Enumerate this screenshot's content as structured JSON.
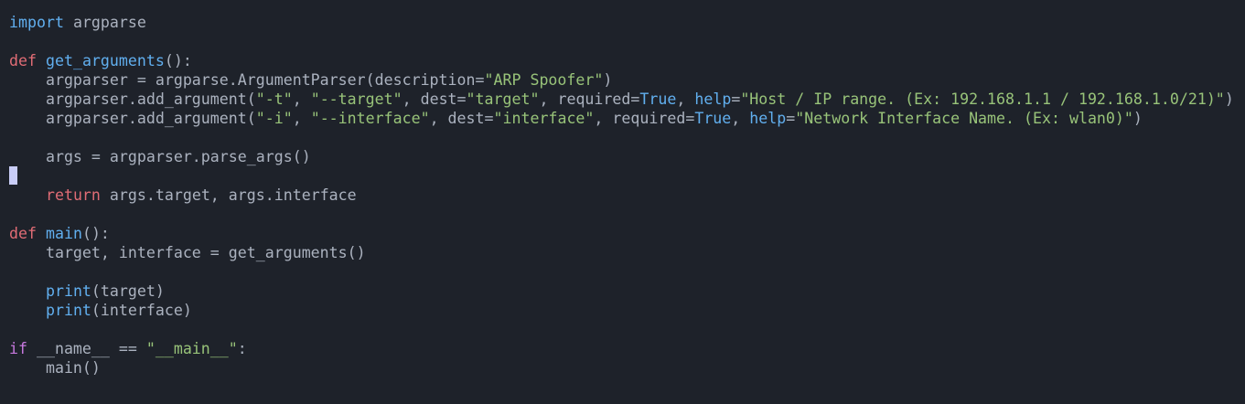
{
  "editor": {
    "theme_colors": {
      "background": "#1e222a",
      "text": "#abb2bf",
      "keyword_def": "#e06c75",
      "keyword_if": "#c678dd",
      "function": "#61afef",
      "string": "#98c379",
      "cursor": "#c9cdf7"
    },
    "lines": [
      [
        {
          "t": "import",
          "k": "import"
        },
        {
          "t": " argparse",
          "k": "plain"
        }
      ],
      [],
      [
        {
          "t": "def",
          "k": "def"
        },
        {
          "t": " ",
          "k": "plain"
        },
        {
          "t": "get_arguments",
          "k": "fn"
        },
        {
          "t": "():",
          "k": "plain"
        }
      ],
      [
        {
          "t": "    argparser = argparse.ArgumentParser(description=",
          "k": "plain"
        },
        {
          "t": "\"ARP Spoofer\"",
          "k": "str"
        },
        {
          "t": ")",
          "k": "plain"
        }
      ],
      [
        {
          "t": "    argparser.add_argument(",
          "k": "plain"
        },
        {
          "t": "\"-t\"",
          "k": "str"
        },
        {
          "t": ", ",
          "k": "plain"
        },
        {
          "t": "\"--target\"",
          "k": "str"
        },
        {
          "t": ", dest=",
          "k": "plain"
        },
        {
          "t": "\"target\"",
          "k": "str"
        },
        {
          "t": ", required=",
          "k": "plain"
        },
        {
          "t": "True",
          "k": "bool"
        },
        {
          "t": ", ",
          "k": "plain"
        },
        {
          "t": "help",
          "k": "kwarg"
        },
        {
          "t": "=",
          "k": "plain"
        },
        {
          "t": "\"Host / IP range. (Ex: 192.168.1.1 / 192.168.1.0/21)\"",
          "k": "str"
        },
        {
          "t": ")",
          "k": "plain"
        }
      ],
      [
        {
          "t": "    argparser.add_argument(",
          "k": "plain"
        },
        {
          "t": "\"-i\"",
          "k": "str"
        },
        {
          "t": ", ",
          "k": "plain"
        },
        {
          "t": "\"--interface\"",
          "k": "str"
        },
        {
          "t": ", dest=",
          "k": "plain"
        },
        {
          "t": "\"interface\"",
          "k": "str"
        },
        {
          "t": ", required=",
          "k": "plain"
        },
        {
          "t": "True",
          "k": "bool"
        },
        {
          "t": ", ",
          "k": "plain"
        },
        {
          "t": "help",
          "k": "kwarg"
        },
        {
          "t": "=",
          "k": "plain"
        },
        {
          "t": "\"Network Interface Name. (Ex: wlan0)\"",
          "k": "str"
        },
        {
          "t": ")",
          "k": "plain"
        }
      ],
      [],
      [
        {
          "t": "    args = argparser.parse_args()",
          "k": "plain"
        }
      ],
      [
        {
          "t": "",
          "k": "cursor"
        }
      ],
      [
        {
          "t": "    ",
          "k": "plain"
        },
        {
          "t": "return",
          "k": "return"
        },
        {
          "t": " args.target, args.interface",
          "k": "plain"
        }
      ],
      [],
      [
        {
          "t": "def",
          "k": "def"
        },
        {
          "t": " ",
          "k": "plain"
        },
        {
          "t": "main",
          "k": "fn"
        },
        {
          "t": "():",
          "k": "plain"
        }
      ],
      [
        {
          "t": "    target, interface = get_arguments()",
          "k": "plain"
        }
      ],
      [],
      [
        {
          "t": "    ",
          "k": "plain"
        },
        {
          "t": "print",
          "k": "builtin"
        },
        {
          "t": "(target)",
          "k": "plain"
        }
      ],
      [
        {
          "t": "    ",
          "k": "plain"
        },
        {
          "t": "print",
          "k": "builtin"
        },
        {
          "t": "(interface)",
          "k": "plain"
        }
      ],
      [],
      [
        {
          "t": "if",
          "k": "if"
        },
        {
          "t": " __name__ == ",
          "k": "plain"
        },
        {
          "t": "\"__main__\"",
          "k": "str"
        },
        {
          "t": ":",
          "k": "plain"
        }
      ],
      [
        {
          "t": "    main()",
          "k": "plain"
        }
      ]
    ]
  }
}
